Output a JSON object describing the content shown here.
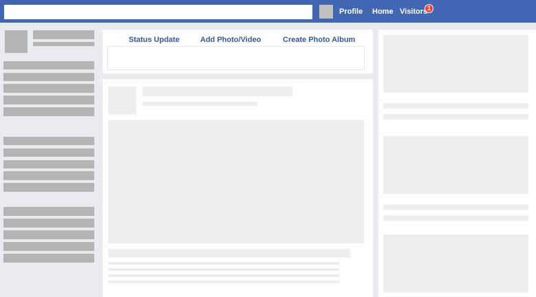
{
  "header": {
    "search": {
      "value": "",
      "placeholder": ""
    },
    "nav": {
      "profile": "Profile",
      "home": "Home",
      "visitors": "Visitors",
      "visitors_badge": "1"
    }
  },
  "composer": {
    "tabs": [
      "Status Update",
      "Add Photo/Video",
      "Create Photo Album"
    ],
    "input": {
      "value": "",
      "placeholder": ""
    }
  },
  "colors": {
    "topbar": "#4267b2",
    "page_background": "#e9ebee",
    "link_blue": "#365899",
    "badge_red": "#fa3e3e",
    "placeholder_dark": "#b4b4b4",
    "placeholder_light": "#eeeeee"
  },
  "icons": {
    "top_avatar": "avatar-placeholder",
    "sidebar_avatar": "avatar-placeholder",
    "post_avatar": "avatar-placeholder"
  }
}
